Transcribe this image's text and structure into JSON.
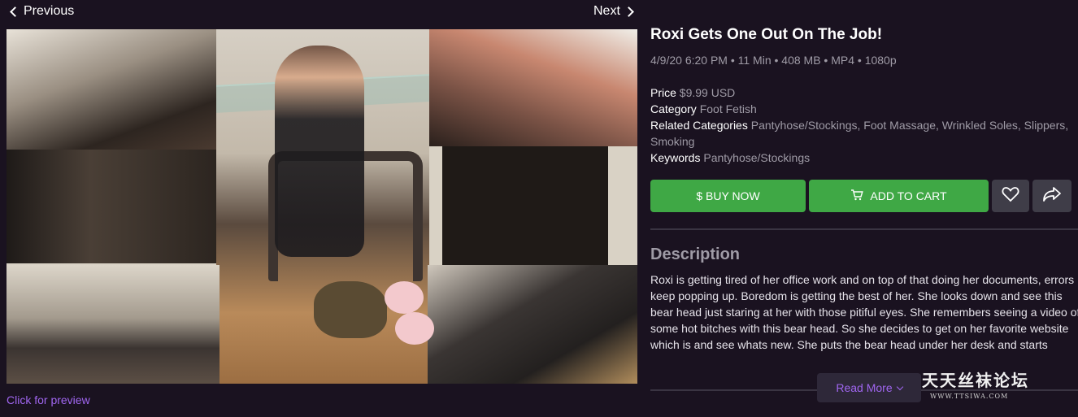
{
  "nav": {
    "previous_label": "Previous",
    "next_label": "Next"
  },
  "preview": {
    "link_label": "Click for preview"
  },
  "product": {
    "title": "Roxi Gets One Out On The Job!",
    "meta": "4/9/20 6:20 PM • 11 Min • 408 MB • MP4 • 1080p",
    "price_label": "Price",
    "price_value": "$9.99 USD",
    "category_label": "Category",
    "category_value": "Foot Fetish",
    "related_label": "Related Categories",
    "related_value_line1": "Pantyhose/Stockings, Foot Massage, Wrinkled Soles, Slippers,",
    "related_value_line2": "Smoking",
    "keywords_label": "Keywords",
    "keywords_value": "Pantyhose/Stockings"
  },
  "actions": {
    "buy_label": "$ BUY NOW",
    "cart_label": "ADD TO CART",
    "favorite_icon": "heart-icon",
    "share_icon": "share-icon"
  },
  "description": {
    "heading": "Description",
    "lines": [
      "Roxi is getting tired of her office work and on top of that doing her documents, errors",
      "keep popping up. Boredom is getting the best of her. She looks down and see this",
      "bear head just staring at her with those pitiful eyes. She remembers seeing a video of",
      "some hot bitches with this bear head. So she decides to get on her favorite website",
      "which is  and see whats new. She puts the bear head under her desk and starts"
    ],
    "read_more_label": "Read More"
  },
  "watermark": {
    "text_cn": "天天丝袜论坛",
    "url": "WWW.TTSIWA.COM"
  },
  "colors": {
    "accent_purple": "#a066f0",
    "button_green": "#3fa845",
    "background": "#1a1220",
    "muted_text": "#9f9ba6"
  }
}
